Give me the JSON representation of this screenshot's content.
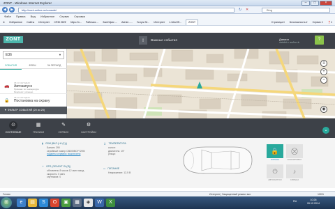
{
  "window": {
    "title": "ZONT - Windows Internet Explorer"
  },
  "browser": {
    "url": "http://zont-online.ru/console/",
    "search_placeholder": "Bing",
    "menu": [
      "Избранное",
      "Сайты",
      "Интернет",
      "CRM ИБФ",
      "https://n...",
      "Рабочая ...",
      "БанОфис ...",
      "Admin -...",
      "Услуги М...",
      "Интернет",
      "L:UtiuOff...",
      "ZONT"
    ],
    "menu_top": [
      "Файл",
      "Правка",
      "Вид",
      "Избранное",
      "Сервис",
      "Справка"
    ],
    "tools": [
      "Страница ▾",
      "Безопасность ▾",
      "Сервис ▾",
      "❓▾"
    ]
  },
  "app": {
    "logo": "ZONT",
    "events_label": "Важные события",
    "user_name": "Даниил",
    "user_sub": "datalink • выйти ⊗",
    "help": "?",
    "device": "Е36",
    "left_tabs": [
      "СОБЫТИЯ",
      "ФЛЕШ",
      "ЗА ПЕРИОД"
    ],
    "events": [
      {
        "time": "08:23 СЕГОДНЯ",
        "title": "Автозапуск",
        "desc": "Причина: по температуре\nРезультат: успешно",
        "icon": "car-icon"
      },
      {
        "time": "08:23 СЕГОДНЯ",
        "title": "Постановка на охрану",
        "desc": "",
        "icon": "lock-icon"
      }
    ],
    "filter_label": "ФИЛЬТР СОБЫТИЙ   (20 из 20)",
    "tabs": [
      {
        "label": "СОСТОЯНИЕ",
        "icon": "⊙"
      },
      {
        "label": "ГРАФИКИ",
        "icon": "▦"
      },
      {
        "label": "СЕРВИС",
        "icon": "✎"
      },
      {
        "label": "НАСТРОЙКИ",
        "icon": "⚙"
      }
    ],
    "gsm": {
      "header": "GSM (Вкл.(+и (1)))",
      "lines": [
        "Баланс 290",
        "серийный номер C8D00BCF72EB",
        "подмена сервера: выключено"
      ]
    },
    "gps": {
      "header": "GPS (объект Ol(я))",
      "lines": [
        "обновлено 8 часов 12 мин назад",
        "скорость: 0 км/ч",
        "спутников: 0"
      ]
    },
    "temperature": {
      "header": "ТЕМПЕРАТУРА",
      "lines": [
        "салон:",
        "двигатель: 15°",
        "улица:"
      ]
    },
    "power": {
      "header": "ПИТАНИЕ",
      "lines": [
        "Напряжение: 12,5 В"
      ]
    },
    "controls": [
      {
        "label": "ОХРАНА",
        "icon": "🔒"
      },
      {
        "label": "БЛОКИРОВКА",
        "icon": "⛒"
      },
      {
        "label": "АВТОЗАПУСК",
        "icon": "⏻"
      },
      {
        "label": "СИРЕНА",
        "icon": "♪"
      }
    ]
  },
  "status": {
    "left": "Готово",
    "zone": "Интернет | Защищенный режим: вкл.",
    "zoom": "100%"
  },
  "taskbar": {
    "time": "10:26",
    "date": "26.12.2014",
    "lang": "RU"
  },
  "colors": {
    "accent": "#29a99c",
    "header": "#3d4148",
    "help": "#8bc34a",
    "alarm_active": "#29a99c"
  }
}
